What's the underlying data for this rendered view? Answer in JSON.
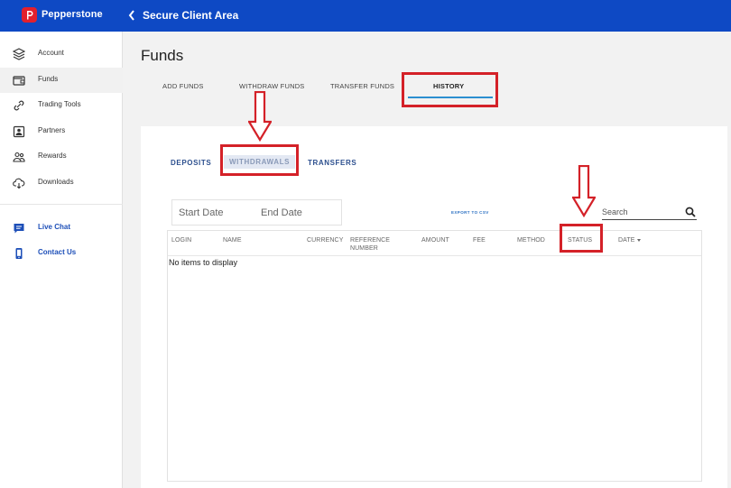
{
  "brand": {
    "name": "Pepperstone",
    "color": "#e3202d"
  },
  "header": {
    "title": "Secure Client Area",
    "background": "#0e49c4"
  },
  "sidebar": {
    "items": [
      {
        "label": "Account",
        "icon": "layers-icon"
      },
      {
        "label": "Funds",
        "icon": "wallet-icon",
        "active": true
      },
      {
        "label": "Trading Tools",
        "icon": "link-icon"
      },
      {
        "label": "Partners",
        "icon": "person-badge-icon"
      },
      {
        "label": "Rewards",
        "icon": "users-icon"
      },
      {
        "label": "Downloads",
        "icon": "cloud-download-icon"
      },
      {
        "label": "Live Chat",
        "icon": "chat-icon"
      },
      {
        "label": "Contact Us",
        "icon": "phone-icon"
      }
    ]
  },
  "page": {
    "title": "Funds"
  },
  "tabs": [
    {
      "label": "ADD FUNDS"
    },
    {
      "label": "WITHDRAW FUNDS"
    },
    {
      "label": "TRANSFER FUNDS"
    },
    {
      "label": "HISTORY",
      "active": true
    }
  ],
  "subtabs": [
    {
      "label": "DEPOSITS"
    },
    {
      "label": "WITHDRAWALS",
      "active": true
    },
    {
      "label": "TRANSFERS"
    }
  ],
  "filters": {
    "start_date_placeholder": "Start Date",
    "end_date_placeholder": "End Date",
    "export_label": "EXPORT TO CSV",
    "search_placeholder": "Search"
  },
  "table": {
    "columns": [
      "LOGIN",
      "NAME",
      "CURRENCY",
      "REFERENCE NUMBER",
      "AMOUNT",
      "FEE",
      "METHOD",
      "STATUS",
      "DATE"
    ],
    "empty_message": "No items to display"
  },
  "colors": {
    "accent": "#2b8fd0",
    "highlight": "#d42128",
    "link": "#2c4f8e"
  }
}
